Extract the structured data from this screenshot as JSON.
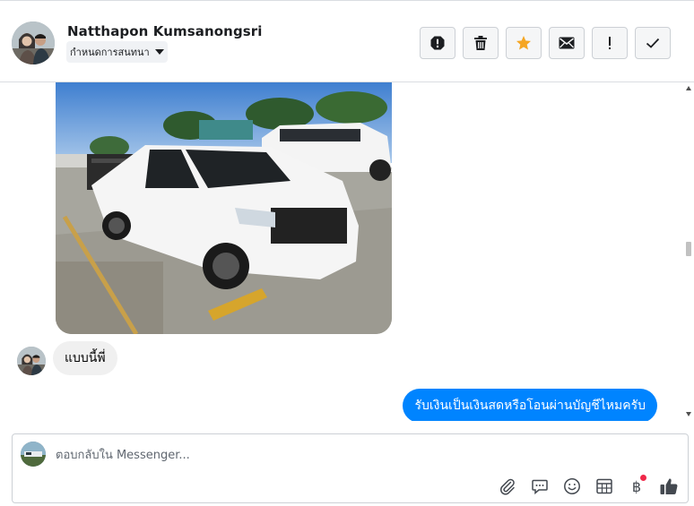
{
  "header": {
    "contact_name": "Natthapon Kumsanongsri",
    "assign_label": "กำหนดการสนทนา",
    "actions": [
      {
        "name": "spam-icon"
      },
      {
        "name": "trash-icon"
      },
      {
        "name": "star-icon",
        "color": "#f5a623"
      },
      {
        "name": "envelope-icon"
      },
      {
        "name": "exclamation-icon"
      },
      {
        "name": "check-icon"
      }
    ]
  },
  "messages": {
    "incoming_text": "แบบนี้พี่",
    "outgoing_text": "รับเงินเป็นเงินสดหรือโอนผ่านบัญชีไหมครับ",
    "outgoing_color": "#0084ff",
    "incoming_color": "#f0f0f0"
  },
  "composer": {
    "placeholder": "ตอบกลับใน Messenger..."
  },
  "tools": [
    "paperclip-icon",
    "chat-bubble-icon",
    "smiley-icon",
    "calendar-grid-icon",
    "baht-icon",
    "thumbs-up-icon"
  ],
  "baht_symbol": "฿"
}
